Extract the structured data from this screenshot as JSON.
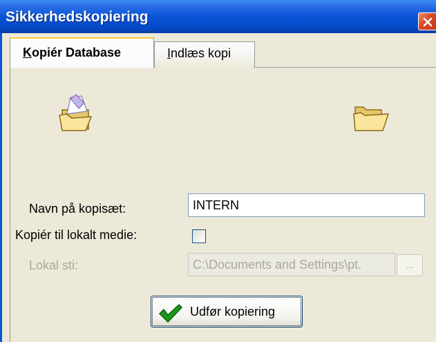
{
  "window": {
    "title": "Sikkerhedskopiering"
  },
  "tabs": [
    {
      "label": "Kopiér Database",
      "accel": "K",
      "rest": "opiér Database",
      "active": true
    },
    {
      "label": "Indlæs kopi",
      "accel": "I",
      "rest": "ndlæs kopi",
      "active": false
    }
  ],
  "icons": {
    "source": "folder-open-document-icon",
    "destination": "folder-open-icon"
  },
  "form": {
    "backup_name_label": "Navn på kopisæt:",
    "backup_name_value": "INTERN",
    "copy_local_label": "Kopiér til lokalt medie:",
    "copy_local_checked": false,
    "local_path_label": "Lokal sti:",
    "local_path_value": "C:\\Documents and Settings\\pt.",
    "browse_label": "...",
    "local_path_enabled": false
  },
  "actions": {
    "run_label": "Udfør kopiering"
  },
  "colors": {
    "titlebar": "#0a54d8",
    "window_bg": "#ece9d8",
    "tab_highlight": "#ffc83c",
    "check_green": "#1a9a1a",
    "close_red": "#d84a24"
  }
}
